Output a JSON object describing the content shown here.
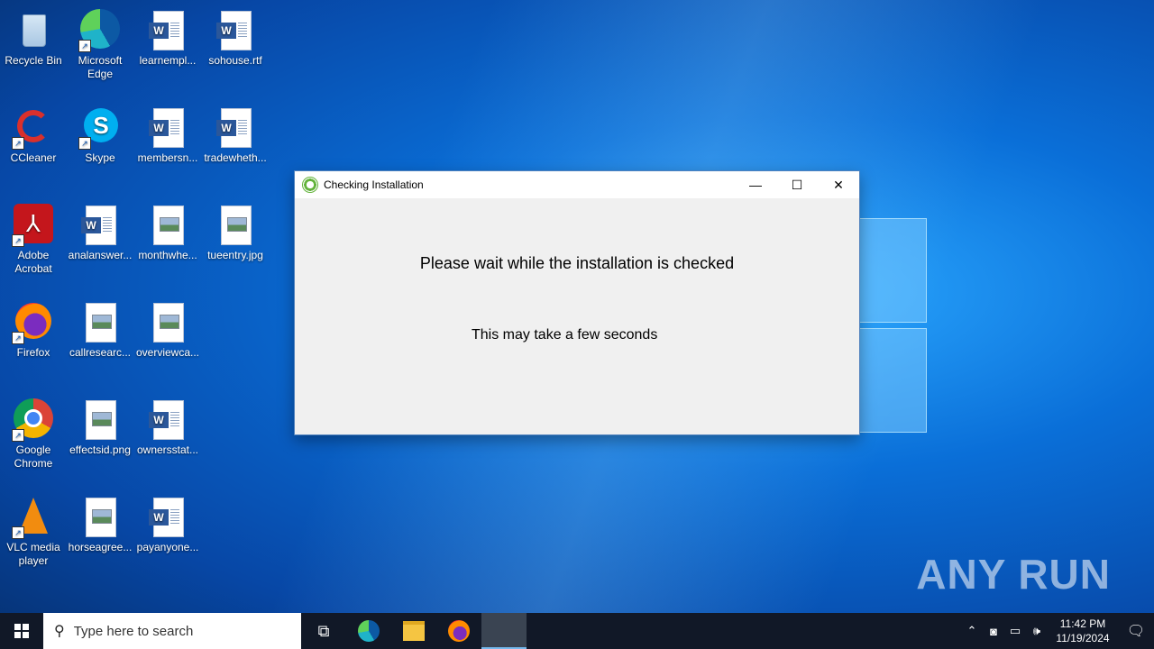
{
  "desktop": {
    "icons": [
      {
        "label": "Recycle Bin"
      },
      {
        "label": "Microsoft Edge"
      },
      {
        "label": "learnempl..."
      },
      {
        "label": "sohouse.rtf"
      },
      {
        "label": "CCleaner"
      },
      {
        "label": "Skype"
      },
      {
        "label": "membersn..."
      },
      {
        "label": "tradewheth..."
      },
      {
        "label": "Adobe Acrobat"
      },
      {
        "label": "analanswer..."
      },
      {
        "label": "monthwhe..."
      },
      {
        "label": "tueentry.jpg"
      },
      {
        "label": "Firefox"
      },
      {
        "label": "callresearc..."
      },
      {
        "label": "overviewca..."
      },
      {
        "label": "Google Chrome"
      },
      {
        "label": "effectsid.png"
      },
      {
        "label": "ownersstat..."
      },
      {
        "label": "VLC media player"
      },
      {
        "label": "horseagree..."
      },
      {
        "label": "payanyone..."
      }
    ]
  },
  "dialog": {
    "title": "Checking Installation",
    "headline": "Please wait while the installation is checked",
    "subline": "This may take a few seconds",
    "minimize": "—",
    "maximize": "☐",
    "close": "✕"
  },
  "watermark": "ANY RUN",
  "taskbar": {
    "search_placeholder": "Type here to search",
    "clock_time": "11:42 PM",
    "clock_date": "11/19/2024"
  }
}
